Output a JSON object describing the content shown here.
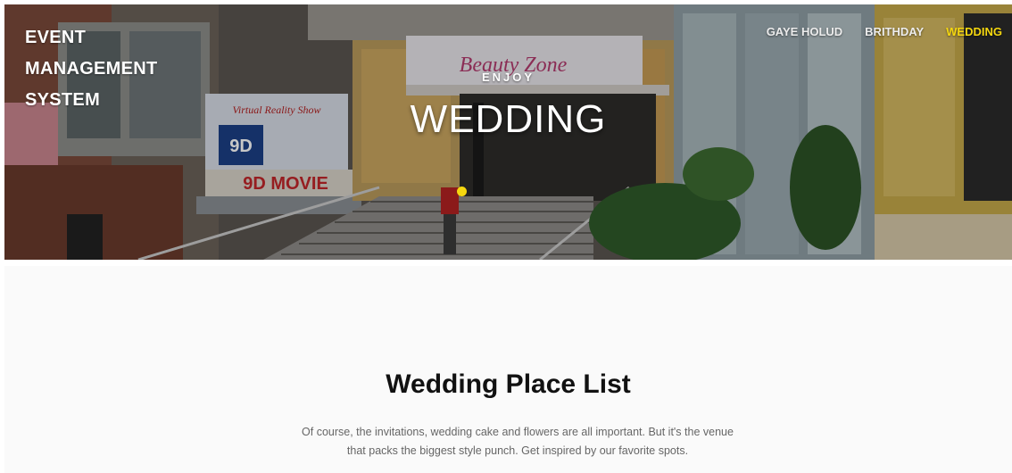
{
  "brand": {
    "line1": "EVENT",
    "line2": "MANAGEMENT",
    "line3": "SYSTEM"
  },
  "nav": {
    "items": [
      {
        "label": "GAYE HOLUD",
        "active": false
      },
      {
        "label": "BRITHDAY",
        "active": false
      },
      {
        "label": "WEDDING",
        "active": true
      }
    ]
  },
  "hero": {
    "subtitle": "ENJOY",
    "title": "WEDDING",
    "sign_beauty": "Beauty Zone",
    "sign_9d": "9D MOVIE",
    "sign_9d_small": "9D",
    "sign_reality": "Virtual Reality Show"
  },
  "section": {
    "title": "Wedding Place List",
    "description_line1": "Of course, the invitations, wedding cake and flowers are all important. But it's the venue",
    "description_line2": "that packs the biggest style punch. Get inspired by our favorite spots."
  },
  "colors": {
    "accent": "#f5d70f",
    "nav_text": "#ececec",
    "dot": "#f5d70f"
  }
}
